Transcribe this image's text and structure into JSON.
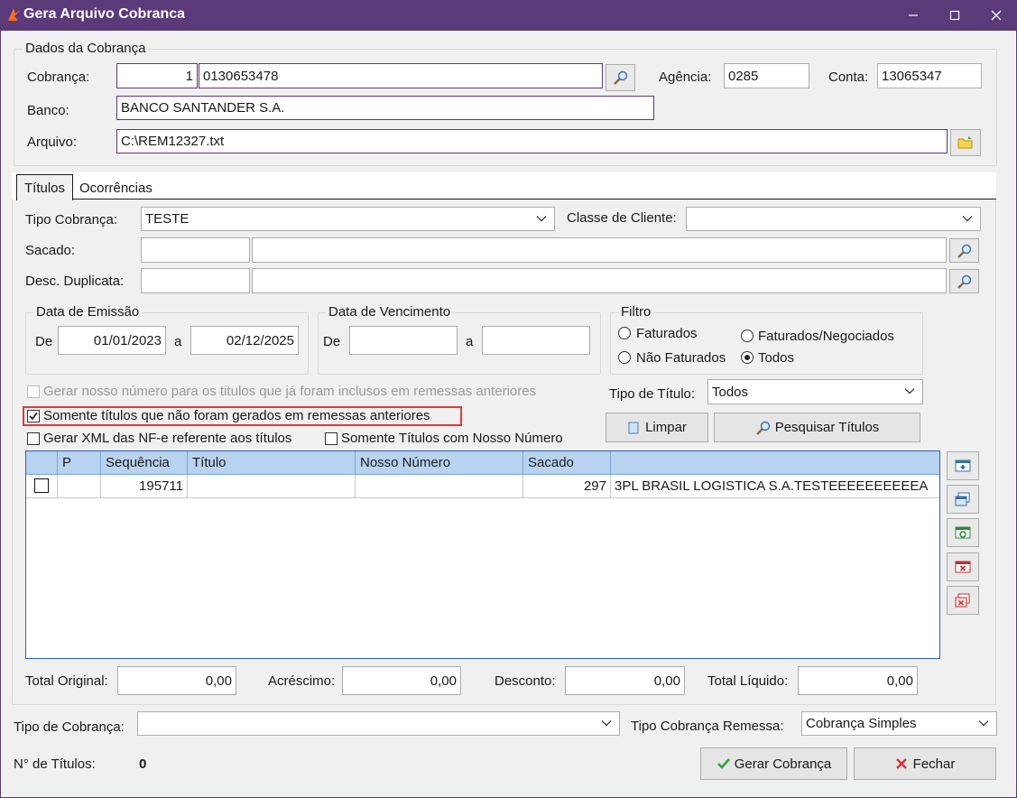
{
  "window": {
    "title": "Gera Arquivo Cobranca"
  },
  "dados": {
    "legend": "Dados da Cobrança",
    "cobranca_label": "Cobrança:",
    "cobranca_num": "1",
    "cobranca_code": "0130653478",
    "agencia_label": "Agência:",
    "agencia_value": "0285",
    "conta_label": "Conta:",
    "conta_value": "13065347",
    "banco_label": "Banco:",
    "banco_value": "BANCO SANTANDER S.A.",
    "arquivo_label": "Arquivo:",
    "arquivo_value": "C:\\REM12327.txt"
  },
  "tabs": [
    {
      "label": "Títulos"
    },
    {
      "label": "Ocorrências"
    }
  ],
  "titulos": {
    "tipo_cobranca_label": "Tipo Cobrança:",
    "tipo_cobranca_value": "TESTE",
    "classe_cliente_label": "Classe de Cliente:",
    "classe_cliente_value": "",
    "sacado_label": "Sacado:",
    "desc_duplicata_label": "Desc. Duplicata:",
    "emissao": {
      "legend": "Data de Emissão",
      "de_label": "De",
      "de_value": "01/01/2023",
      "a_label": "a",
      "a_value": "02/12/2025"
    },
    "vencimento": {
      "legend": "Data de Vencimento",
      "de_label": "De",
      "de_value": "",
      "a_label": "a",
      "a_value": ""
    },
    "filtro": {
      "legend": "Filtro",
      "opt_faturados": "Faturados",
      "opt_faturados_negociados": "Faturados/Negociados",
      "opt_nao_faturados": "Não Faturados",
      "opt_todos": "Todos",
      "selected": "Todos"
    },
    "chk_gerar_nosso_numero": "Gerar nosso número para os titulos que já foram inclusos em remessas anteriores",
    "chk_somente_nao_gerados": "Somente títulos que não foram gerados em remessas anteriores",
    "chk_gerar_xml": "Gerar XML das NF-e referente aos títulos",
    "chk_somente_nosso_numero": "Somente Títulos com Nosso Número",
    "tipo_titulo_label": "Tipo de Título:",
    "tipo_titulo_value": "Todos",
    "limpar_label": "Limpar",
    "pesquisar_label": "Pesquisar Títulos"
  },
  "grid": {
    "columns": [
      "P",
      "Sequência",
      "Título",
      "Nosso Número",
      "Sacado"
    ],
    "rows": [
      {
        "p": "",
        "sequencia": "195711",
        "titulo": "",
        "nosso_numero": "",
        "sacado_cod": "297",
        "sacado_nome": "3PL BRASIL LOGISTICA S.A.TESTEEEEEEEEEEA"
      }
    ]
  },
  "totals": {
    "original_label": "Total Original:",
    "original_value": "0,00",
    "acrescimo_label": "Acréscimo:",
    "acrescimo_value": "0,00",
    "desconto_label": "Desconto:",
    "desconto_value": "0,00",
    "liquido_label": "Total Líquido:",
    "liquido_value": "0,00"
  },
  "footer": {
    "tipo_cobranca_label": "Tipo de Cobrança:",
    "tipo_cobranca_value": "",
    "tipo_remessa_label": "Tipo Cobrança Remessa:",
    "tipo_remessa_value": "Cobrança Simples",
    "num_titulos_label": "N° de Títulos:",
    "num_titulos_value": "0",
    "gerar_label": "Gerar Cobrança",
    "fechar_label": "Fechar"
  },
  "colors": {
    "titlebar": "#5b3a7a",
    "grid_header": "#b8d3f0",
    "highlight": "#e03a3a"
  }
}
